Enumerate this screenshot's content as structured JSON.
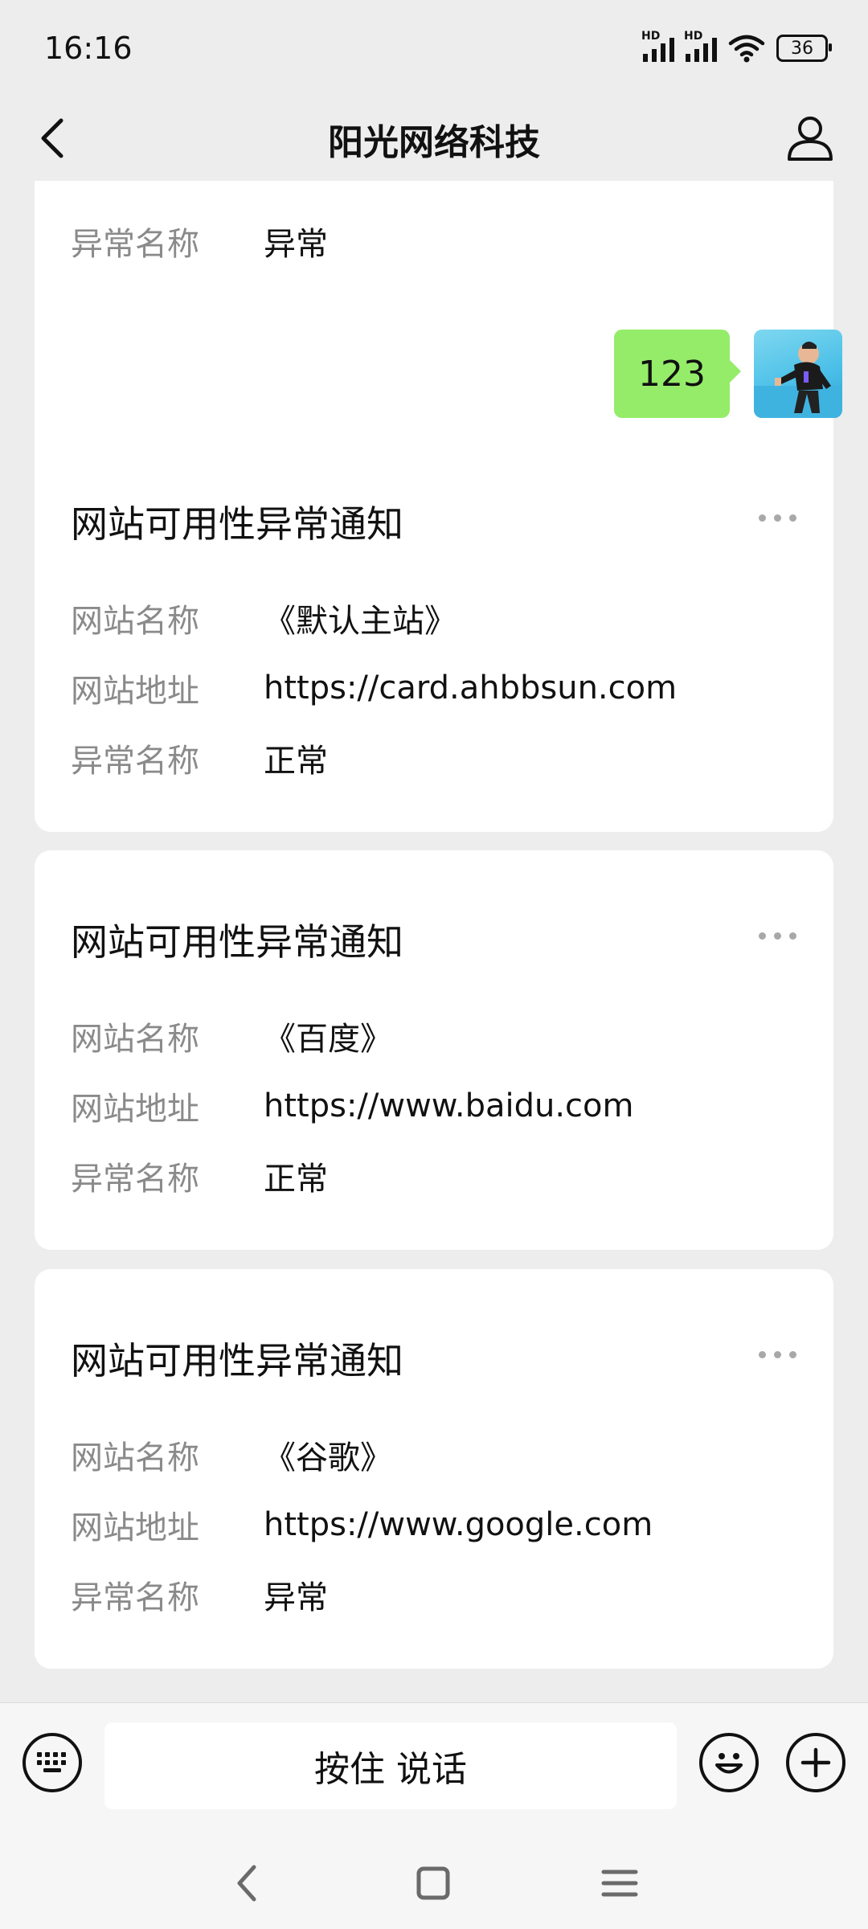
{
  "status_bar": {
    "time": "16:16",
    "signal_label_1": "HD",
    "signal_label_2": "HD",
    "battery": "36"
  },
  "header": {
    "title": "阳光网络科技",
    "back_icon": "chevron-left-icon",
    "profile_icon": "person-icon"
  },
  "messages": {
    "top_card": {
      "rows": [
        {
          "label": "异常名称",
          "value": "异常"
        }
      ]
    },
    "user_message": {
      "text": "123"
    },
    "cards": [
      {
        "title": "网站可用性异常通知",
        "rows": [
          {
            "label": "网站名称",
            "value": "《默认主站》"
          },
          {
            "label": "网站地址",
            "value": "https://card.ahbbsun.com"
          },
          {
            "label": "异常名称",
            "value": "正常"
          }
        ]
      },
      {
        "title": "网站可用性异常通知",
        "rows": [
          {
            "label": "网站名称",
            "value": "《百度》"
          },
          {
            "label": "网站地址",
            "value": "https://www.baidu.com"
          },
          {
            "label": "异常名称",
            "value": "正常"
          }
        ]
      },
      {
        "title": "网站可用性异常通知",
        "rows": [
          {
            "label": "网站名称",
            "value": "《谷歌》"
          },
          {
            "label": "网站地址",
            "value": "https://www.google.com"
          },
          {
            "label": "异常名称",
            "value": "异常"
          }
        ]
      }
    ]
  },
  "input_bar": {
    "keyboard_icon": "keyboard-icon",
    "hold_to_talk": "按住 说话",
    "emoji_icon": "smiley-icon",
    "plus_icon": "plus-circle-icon"
  },
  "system_nav": {
    "back_icon": "back-triangle-icon",
    "home_icon": "home-square-icon",
    "menu_icon": "menu-lines-icon"
  },
  "colors": {
    "background": "#ededed",
    "bubble": "#95ec69",
    "card": "#ffffff",
    "label": "#8a8a8a"
  }
}
